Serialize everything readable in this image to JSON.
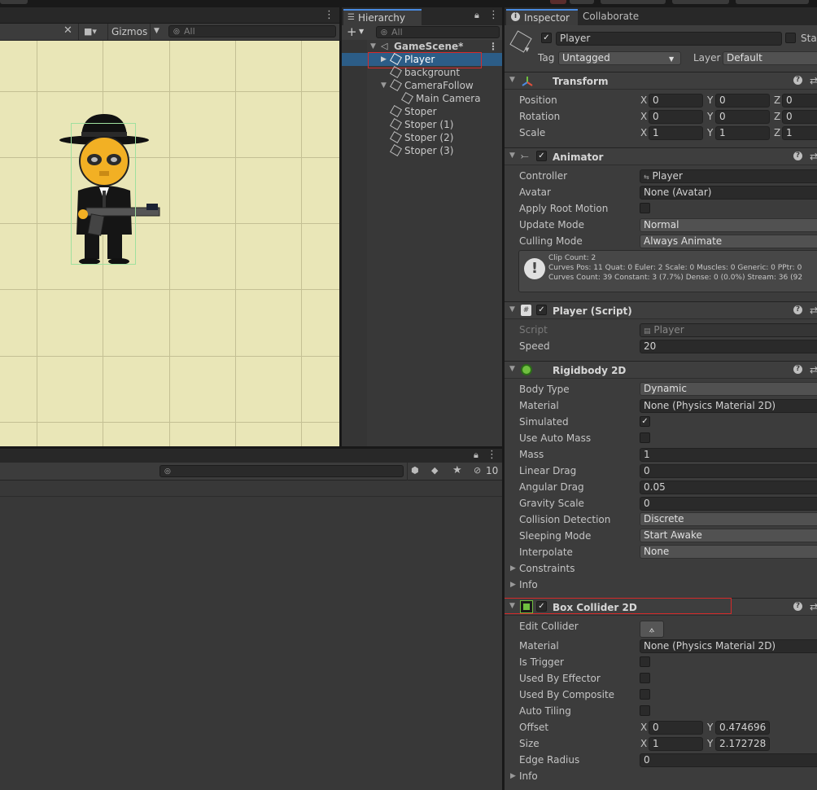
{
  "scene": {
    "gizmos_label": "Gizmos",
    "search_placeholder": "All"
  },
  "hierarchy": {
    "tab_label": "Hierarchy",
    "search_placeholder": "All",
    "scene_name": "GameScene*",
    "items": [
      {
        "label": "Player"
      },
      {
        "label": "backgrount"
      },
      {
        "label": "CameraFollow"
      },
      {
        "label": "Main Camera"
      },
      {
        "label": "Stoper"
      },
      {
        "label": "Stoper (1)"
      },
      {
        "label": "Stoper (2)"
      },
      {
        "label": "Stoper (3)"
      }
    ]
  },
  "project": {
    "hidden_count": "10"
  },
  "inspector": {
    "tab_label": "Inspector",
    "tab2_label": "Collaborate",
    "object_name": "Player",
    "static_label": "Sta",
    "tag_label": "Tag",
    "tag_value": "Untagged",
    "layer_label": "Layer",
    "layer_value": "Default",
    "transform": {
      "title": "Transform",
      "rows": [
        {
          "label": "Position",
          "x": "0",
          "y": "0",
          "z": "0"
        },
        {
          "label": "Rotation",
          "x": "0",
          "y": "0",
          "z": "0"
        },
        {
          "label": "Scale",
          "x": "1",
          "y": "1",
          "z": "1"
        }
      ]
    },
    "animator": {
      "title": "Animator",
      "controller_label": "Controller",
      "controller_value": "Player",
      "avatar_label": "Avatar",
      "avatar_value": "None (Avatar)",
      "apply_root_motion_label": "Apply Root Motion",
      "update_mode_label": "Update Mode",
      "update_mode_value": "Normal",
      "culling_mode_label": "Culling Mode",
      "culling_mode_value": "Always Animate",
      "info_line1": "Clip Count: 2",
      "info_line2": "Curves Pos: 11 Quat: 0 Euler: 2 Scale: 0 Muscles: 0 Generic: 0 PPtr: 0",
      "info_line3": "Curves Count: 39 Constant: 3 (7.7%) Dense: 0 (0.0%) Stream: 36 (92"
    },
    "player_script": {
      "title": "Player (Script)",
      "script_label": "Script",
      "script_value": "Player",
      "speed_label": "Speed",
      "speed_value": "20"
    },
    "rigidbody": {
      "title": "Rigidbody 2D",
      "body_type_label": "Body Type",
      "body_type_value": "Dynamic",
      "material_label": "Material",
      "material_value": "None (Physics Material 2D)",
      "simulated_label": "Simulated",
      "use_auto_mass_label": "Use Auto Mass",
      "mass_label": "Mass",
      "mass_value": "1",
      "linear_drag_label": "Linear Drag",
      "linear_drag_value": "0",
      "angular_drag_label": "Angular Drag",
      "angular_drag_value": "0.05",
      "gravity_scale_label": "Gravity Scale",
      "gravity_scale_value": "0",
      "collision_detection_label": "Collision Detection",
      "collision_detection_value": "Discrete",
      "sleeping_mode_label": "Sleeping Mode",
      "sleeping_mode_value": "Start Awake",
      "interpolate_label": "Interpolate",
      "interpolate_value": "None",
      "constraints_label": "Constraints",
      "info_label": "Info"
    },
    "box_collider": {
      "title": "Box Collider 2D",
      "edit_collider_label": "Edit Collider",
      "material_label": "Material",
      "material_value": "None (Physics Material 2D)",
      "is_trigger_label": "Is Trigger",
      "used_by_effector_label": "Used By Effector",
      "used_by_composite_label": "Used By Composite",
      "auto_tiling_label": "Auto Tiling",
      "offset_label": "Offset",
      "offset_x": "0",
      "offset_y": "0.474696",
      "size_label": "Size",
      "size_x": "1",
      "size_y": "2.172728",
      "edge_radius_label": "Edge Radius",
      "edge_radius_value": "0",
      "info_label": "Info"
    }
  }
}
